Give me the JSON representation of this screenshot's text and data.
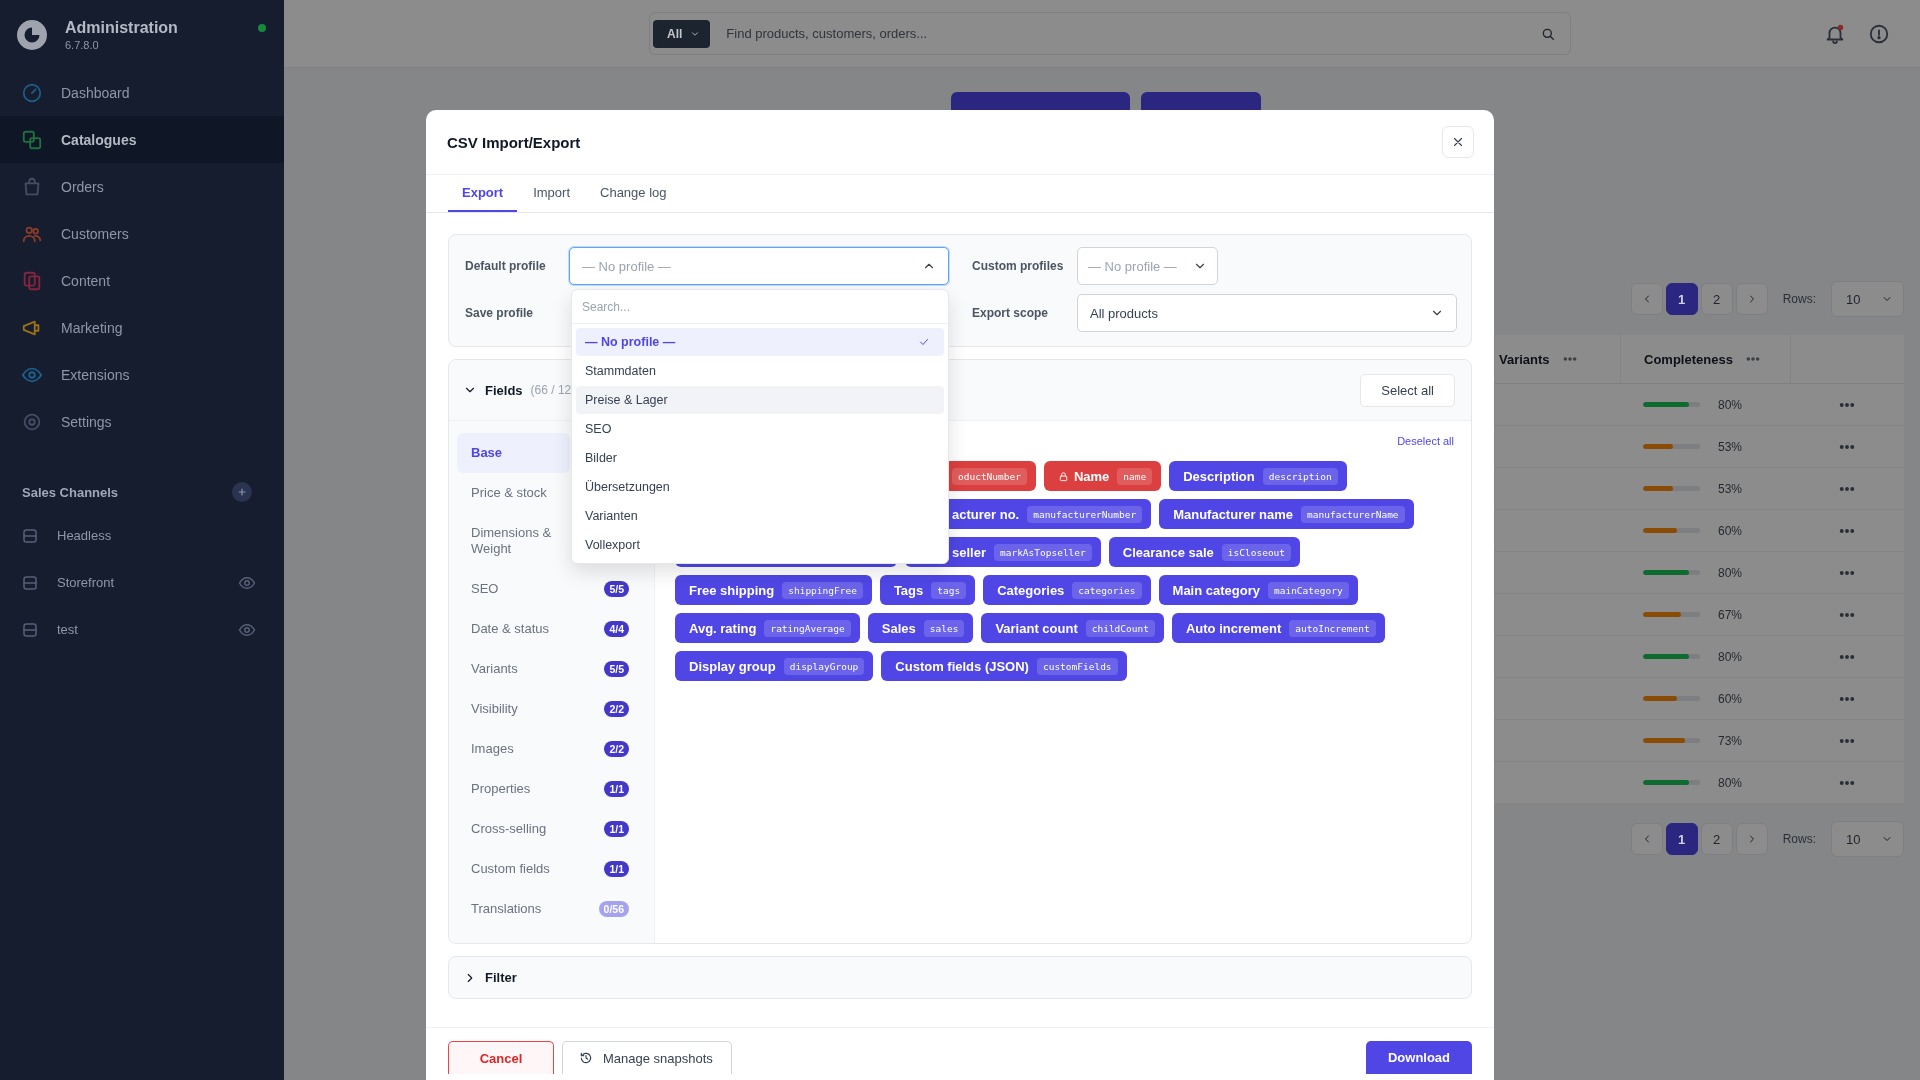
{
  "admin_sidebar": {
    "title": "Administration",
    "version": "6.7.8.0",
    "online": true,
    "items": [
      {
        "label": "Dashboard",
        "selected": false,
        "color": "#1f5a82"
      },
      {
        "label": "Catalogues",
        "selected": true,
        "color": "#1f7040"
      },
      {
        "label": "Orders",
        "selected": false,
        "color": "#434d63"
      },
      {
        "label": "Customers",
        "selected": false,
        "color": "#8a3b27"
      },
      {
        "label": "Content",
        "selected": false,
        "color": "#852540"
      },
      {
        "label": "Marketing",
        "selected": false,
        "color": "#9a7414"
      },
      {
        "label": "Extensions",
        "selected": false,
        "color": "#1d5f8f"
      },
      {
        "label": "Settings",
        "selected": false,
        "color": "#434d63"
      }
    ],
    "sales_channels": {
      "title": "Sales Channels",
      "items": [
        {
          "label": "Headless",
          "visible": false
        },
        {
          "label": "Storefront",
          "visible": true
        },
        {
          "label": "test",
          "visible": true
        }
      ]
    }
  },
  "header": {
    "search": {
      "scope": "All",
      "placeholder": "Find products, customers, orders..."
    },
    "notifications": {
      "unread": true
    }
  },
  "product_table": {
    "columns": [
      "Variants",
      "Completeness"
    ],
    "rows": [
      {
        "level": 0.8,
        "reading": "80%",
        "color": "#0f6a30"
      },
      {
        "level": 0.53,
        "reading": "53%",
        "color": "#8a4c05"
      },
      {
        "level": 0.53,
        "reading": "53%",
        "color": "#8a4c05"
      },
      {
        "level": 0.6,
        "reading": "60%",
        "color": "#8a4c05"
      },
      {
        "level": 0.8,
        "reading": "80%",
        "color": "#0f6a30"
      },
      {
        "level": 0.67,
        "reading": "67%",
        "color": "#8a4c05"
      },
      {
        "level": 0.8,
        "reading": "80%",
        "color": "#0f6a30"
      },
      {
        "level": 0.6,
        "reading": "60%",
        "color": "#8a4c05"
      },
      {
        "level": 0.73,
        "reading": "73%",
        "color": "#8a4c05"
      },
      {
        "level": 0.8,
        "reading": "80%",
        "color": "#0f6a30"
      }
    ],
    "paginations": [
      {
        "pages": [
          {
            "label": "1",
            "selected": true
          },
          {
            "label": "2",
            "selected": false
          }
        ],
        "rows_label": "Rows:",
        "rows_value": "10"
      },
      {
        "pages": [
          {
            "label": "1",
            "selected": true
          },
          {
            "label": "2",
            "selected": false
          }
        ],
        "rows_label": "Rows:",
        "rows_value": "10"
      }
    ]
  },
  "modal": {
    "title": "CSV Import/Export",
    "tabs": [
      {
        "label": "Export",
        "selected": true
      },
      {
        "label": "Import",
        "selected": false
      },
      {
        "label": "Change log",
        "selected": false
      }
    ],
    "profile": {
      "default_profile": {
        "label": "Default profile",
        "placeholder": "— No profile —",
        "expanded": true
      },
      "custom_profiles": {
        "label": "Custom profiles",
        "placeholder": "— No profile —"
      },
      "save_profile": {
        "label": "Save profile"
      },
      "export_scope": {
        "label": "Export scope",
        "value": "All products"
      }
    },
    "dropdown": {
      "placeholder": "Search...",
      "options": [
        {
          "label": "— No profile —",
          "selected": true,
          "hovered": false
        },
        {
          "label": "Stammdaten",
          "selected": false,
          "hovered": false
        },
        {
          "label": "Preise & Lager",
          "selected": false,
          "hovered": true
        },
        {
          "label": "SEO",
          "selected": false,
          "hovered": false
        },
        {
          "label": "Bilder",
          "selected": false,
          "hovered": false
        },
        {
          "label": "Übersetzungen",
          "selected": false,
          "hovered": false
        },
        {
          "label": "Varianten",
          "selected": false,
          "hovered": false
        },
        {
          "label": "Vollexport",
          "selected": false,
          "hovered": false
        }
      ]
    },
    "fields": {
      "title": "Fields",
      "count": "(66 / 12",
      "expanded": true,
      "select_all": "Select all",
      "deselect_all": "Deselect all",
      "groups": [
        {
          "label": "Base",
          "selected": true
        },
        {
          "label": "Price & stock",
          "selected": false
        },
        {
          "label": "Dimensions & Weight",
          "selected": false
        },
        {
          "label": "SEO",
          "selected": false,
          "badge": "5/5",
          "complete": true
        },
        {
          "label": "Date & status",
          "selected": false,
          "badge": "4/4",
          "complete": true
        },
        {
          "label": "Variants",
          "selected": false,
          "badge": "5/5",
          "complete": true
        },
        {
          "label": "Visibility",
          "selected": false,
          "badge": "2/2",
          "complete": true
        },
        {
          "label": "Images",
          "selected": false,
          "badge": "2/2",
          "complete": true
        },
        {
          "label": "Properties",
          "selected": false,
          "badge": "1/1",
          "complete": true
        },
        {
          "label": "Cross-selling",
          "selected": false,
          "badge": "1/1",
          "complete": true
        },
        {
          "label": "Custom fields",
          "selected": false,
          "badge": "1/1",
          "complete": true
        },
        {
          "label": "Translations",
          "selected": false,
          "badge": "0/56",
          "complete": false
        }
      ],
      "chip_rows": [
        [
          {
            "kind": "cut",
            "code": "oductNumber",
            "required": true
          },
          {
            "kind": "full",
            "label": "Name",
            "code": "name",
            "required": true,
            "locked": true
          },
          {
            "kind": "full",
            "label": "Description",
            "code": "description",
            "required": false
          }
        ],
        [
          {
            "kind": "cut",
            "label": "acturer no.",
            "code": "manufacturerNumber",
            "required": false
          },
          {
            "kind": "full",
            "label": "Manufacturer name",
            "code": "manufacturerName",
            "required": false
          }
        ],
        [
          {
            "kind": "blank",
            "required": false
          },
          {
            "kind": "cut",
            "label": "seller",
            "code": "markAsTopseller",
            "required": false
          },
          {
            "kind": "full",
            "label": "Clearance sale",
            "code": "isCloseout",
            "required": false
          }
        ],
        [
          {
            "kind": "full",
            "label": "Free shipping",
            "code": "shippingFree",
            "required": false
          },
          {
            "kind": "full",
            "label": "Tags",
            "code": "tags",
            "required": false
          },
          {
            "kind": "full",
            "label": "Categories",
            "code": "categories",
            "required": false
          },
          {
            "kind": "full",
            "label": "Main category",
            "code": "mainCategory",
            "required": false
          }
        ],
        [
          {
            "kind": "full",
            "label": "Avg. rating",
            "code": "ratingAverage",
            "required": false
          },
          {
            "kind": "full",
            "label": "Sales",
            "code": "sales",
            "required": false
          },
          {
            "kind": "full",
            "label": "Variant count",
            "code": "childCount",
            "required": false
          },
          {
            "kind": "full",
            "label": "Auto increment",
            "code": "autoIncrement",
            "required": false
          }
        ],
        [
          {
            "kind": "full",
            "label": "Display group",
            "code": "displayGroup",
            "required": false
          },
          {
            "kind": "full",
            "label": "Custom fields (JSON)",
            "code": "customFields",
            "required": false
          }
        ]
      ]
    },
    "filter": {
      "title": "Filter",
      "expanded": false
    },
    "footer": {
      "cancel": "Cancel",
      "snapshots": "Manage snapshots",
      "download": "Download"
    }
  }
}
